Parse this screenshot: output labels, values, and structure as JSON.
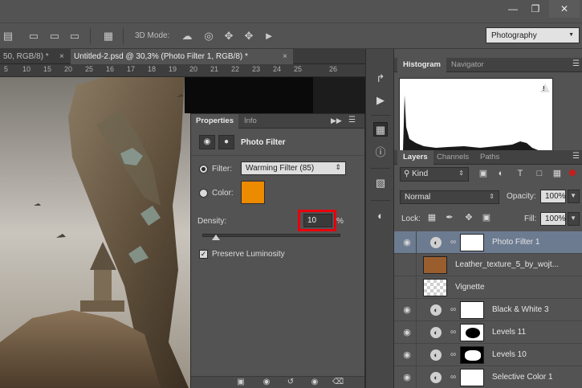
{
  "toolbar": {
    "mode_3d_label": "3D Mode:",
    "workspace": "Photography"
  },
  "document_tabs": [
    {
      "label": "50, RGB/8) *",
      "active": false
    },
    {
      "label": "Untitled-2.psd @ 30,3% (Photo Filter 1, RGB/8) *",
      "active": true
    }
  ],
  "ruler_ticks": [
    "5",
    "10",
    "15",
    "20",
    "25",
    "16",
    "17",
    "18",
    "19",
    "20",
    "21",
    "22",
    "23",
    "24",
    "25",
    "26"
  ],
  "properties_panel": {
    "tabs": [
      "Properties",
      "Info"
    ],
    "title": "Photo Filter",
    "filter_label": "Filter:",
    "filter_value": "Warming Filter (85)",
    "color_label": "Color:",
    "color_value": "#ec8a00",
    "density_label": "Density:",
    "density_value": "10",
    "density_unit": "%",
    "density_fraction": 0.1,
    "preserve_luminosity_label": "Preserve Luminosity",
    "preserve_luminosity_checked": true
  },
  "histogram_panel": {
    "tabs": [
      "Histogram",
      "Navigator"
    ]
  },
  "layers_panel": {
    "tabs": [
      "Layers",
      "Channels",
      "Paths"
    ],
    "filter_kind": "Kind",
    "blend_mode": "Normal",
    "opacity_label": "Opacity:",
    "opacity_value": "100%",
    "lock_label": "Lock:",
    "fill_label": "Fill:",
    "fill_value": "100%",
    "layers": [
      {
        "name": "Photo Filter 1",
        "type": "adjustment",
        "mask": "white",
        "selected": true
      },
      {
        "name": "Leather_texture_5_by_wojt...",
        "type": "smart-object",
        "selected": false
      },
      {
        "name": "Vignette",
        "type": "pixel",
        "selected": false
      },
      {
        "name": "Black & White 3",
        "type": "adjustment",
        "mask": "white",
        "selected": false
      },
      {
        "name": "Levels 11",
        "type": "adjustment",
        "mask": "ellipse",
        "selected": false
      },
      {
        "name": "Levels 10",
        "type": "adjustment",
        "mask": "blob",
        "selected": false
      },
      {
        "name": "Selective Color 1",
        "type": "adjustment",
        "mask": "white",
        "selected": false
      }
    ]
  },
  "colors": {
    "accent_highlight": "#e8000c",
    "selected_layer": "#6c7b90",
    "photo_filter_color": "#ec8a00"
  }
}
